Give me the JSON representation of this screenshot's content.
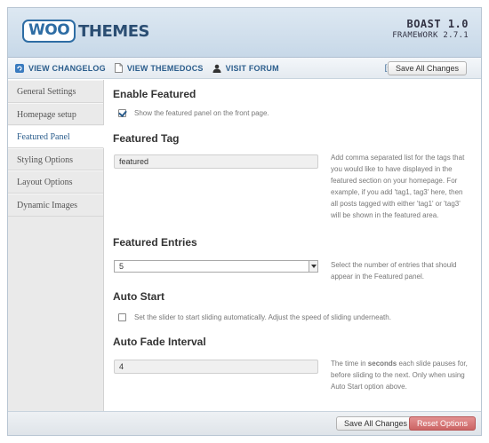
{
  "header": {
    "logo_woo": "WOO",
    "logo_themes": "THEMES",
    "theme_name": "BOAST 1.0",
    "framework": "FRAMEWORK 2.7.1"
  },
  "subbar": {
    "links": [
      {
        "label": "VIEW CHANGELOG",
        "icon": "refresh-icon"
      },
      {
        "label": "VIEW THEMEDOCS",
        "icon": "document-icon"
      },
      {
        "label": "VISIT FORUM",
        "icon": "user-icon"
      }
    ],
    "expand": "[+]",
    "save_label": "Save All Changes"
  },
  "sidebar": {
    "items": [
      {
        "label": "General Settings"
      },
      {
        "label": "Homepage setup"
      },
      {
        "label": "Featured Panel"
      },
      {
        "label": "Styling Options"
      },
      {
        "label": "Layout Options"
      },
      {
        "label": "Dynamic Images"
      }
    ],
    "active_index": 2
  },
  "main": {
    "enable_featured": {
      "title": "Enable Featured",
      "checkbox_label": "Show the featured panel on the front page.",
      "checked": true
    },
    "featured_tag": {
      "title": "Featured Tag",
      "value": "featured",
      "desc": "Add comma separated list for the tags that you would like to have displayed in the featured section on your homepage. For example, if you add 'tag1, tag3' here, then all posts tagged with either 'tag1' or 'tag3' will be shown in the featured area."
    },
    "featured_entries": {
      "title": "Featured Entries",
      "value": "5",
      "desc": "Select the number of entries that should appear in the Featured panel."
    },
    "auto_start": {
      "title": "Auto Start",
      "checkbox_label": "Set the slider to start sliding automatically. Adjust the speed of sliding underneath.",
      "checked": false
    },
    "auto_fade": {
      "title": "Auto Fade Interval",
      "value": "4",
      "desc_pre": "The time in ",
      "desc_bold": "seconds",
      "desc_post": " each slide pauses for, before sliding to the next. Only when using Auto Start option above."
    }
  },
  "footer": {
    "save_label": "Save All Changes",
    "reset_label": "Reset Options"
  },
  "colors": {
    "link": "#2b5d8c",
    "reset_button": "#cc6464"
  }
}
